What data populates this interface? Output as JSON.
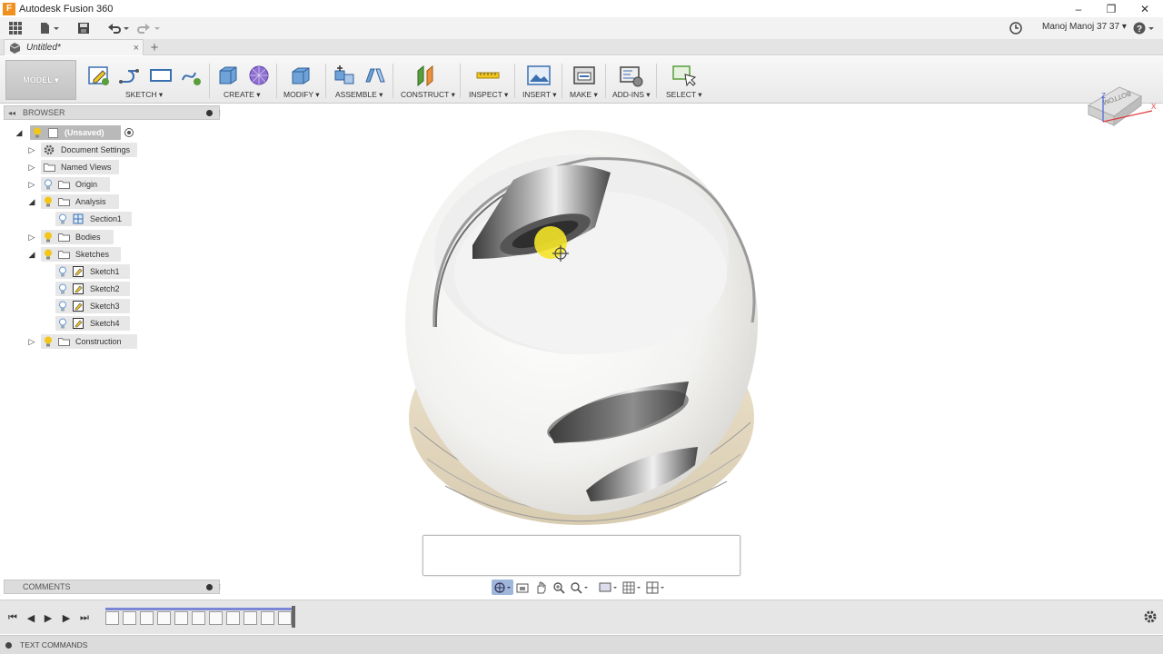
{
  "window": {
    "title": "Autodesk Fusion 360",
    "app_icon": "F",
    "controls": {
      "minimize": "–",
      "restore": "❐",
      "close": "✕"
    }
  },
  "quick_access": {
    "user": "Manoj Manoj 37 37",
    "icons": [
      "data-panel-icon",
      "file-icon",
      "save-icon",
      "undo-icon",
      "redo-icon",
      "job-status-icon",
      "help-icon"
    ]
  },
  "tabs": {
    "document": "Untitled*",
    "close": "×",
    "new": "+"
  },
  "toolbar": {
    "workspace": "MODEL ▾",
    "groups": [
      {
        "label": "SKETCH ▾"
      },
      {
        "label": "CREATE ▾"
      },
      {
        "label": "MODIFY ▾"
      },
      {
        "label": "ASSEMBLE ▾"
      },
      {
        "label": "CONSTRUCT ▾"
      },
      {
        "label": "INSPECT ▾"
      },
      {
        "label": "INSERT ▾"
      },
      {
        "label": "MAKE ▾"
      },
      {
        "label": "ADD-INS ▾"
      },
      {
        "label": "SELECT ▾"
      }
    ]
  },
  "browser": {
    "title": "BROWSER",
    "root": "(Unsaved)",
    "items": [
      {
        "label": "Document Settings"
      },
      {
        "label": "Named Views"
      },
      {
        "label": "Origin"
      },
      {
        "label": "Analysis"
      },
      {
        "label": "Section1"
      },
      {
        "label": "Bodies"
      },
      {
        "label": "Sketches"
      },
      {
        "label": "Sketch1"
      },
      {
        "label": "Sketch2"
      },
      {
        "label": "Sketch3"
      },
      {
        "label": "Sketch4"
      },
      {
        "label": "Construction"
      }
    ]
  },
  "comments": {
    "title": "COMMENTS"
  },
  "viewcube": {
    "face": "BOTTOM",
    "axis_z": "Z",
    "axis_x": "X"
  },
  "bottom": {
    "text_commands": "TEXT COMMANDS"
  },
  "colors": {
    "accent": "#7b86d6",
    "bulb": "#f2c61a",
    "toolbar_bg": "#eeeeee"
  }
}
